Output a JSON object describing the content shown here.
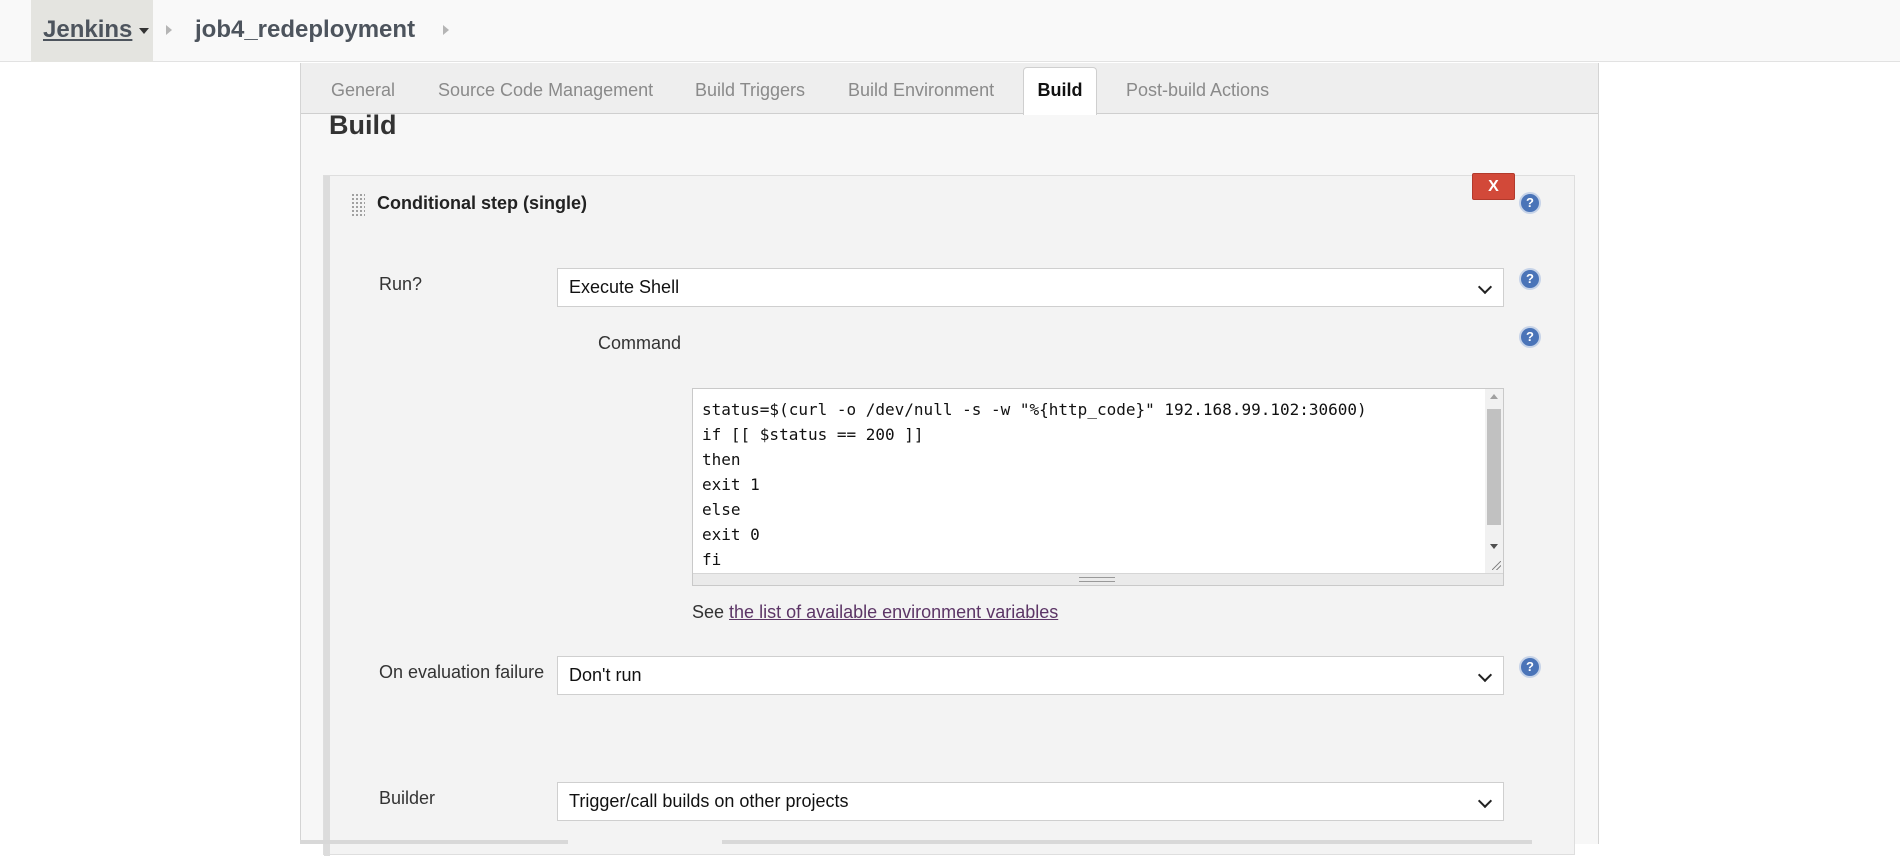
{
  "breadcrumb": {
    "root": "Jenkins",
    "job": "job4_redeployment"
  },
  "tabs": {
    "general": "General",
    "scm": "Source Code Management",
    "triggers": "Build Triggers",
    "environment": "Build Environment",
    "build": "Build",
    "post_build": "Post-build Actions",
    "active": "Build"
  },
  "section": {
    "title": "Build"
  },
  "step": {
    "title": "Conditional step (single)",
    "delete_label": "X",
    "help_label": "?",
    "run": {
      "label": "Run?",
      "value": "Execute Shell"
    },
    "command": {
      "label": "Command",
      "lines": [
        "status=$(curl -o /dev/null -s -w \"%{http_code}\" 192.168.99.102:30600)",
        "if [[ $status == 200 ]]",
        "then",
        "exit 1",
        "else",
        "exit 0",
        "fi"
      ]
    },
    "env_vars": {
      "prefix": "See",
      "link": "the list of available environment variables"
    },
    "on_failure": {
      "label": "On evaluation failure",
      "value": "Don't run"
    },
    "builder": {
      "label": "Builder",
      "value": "Trigger/call builds on other projects"
    }
  },
  "colors": {
    "delete_button": "#d24939",
    "help_icon": "#4a74b8",
    "link": "#5c3566",
    "active_tab_bg": "#ffffff"
  },
  "icons": [
    "chevron-down-icon",
    "breadcrumb-arrow-icon",
    "drag-handle-icon",
    "help-icon",
    "delete-icon"
  ]
}
